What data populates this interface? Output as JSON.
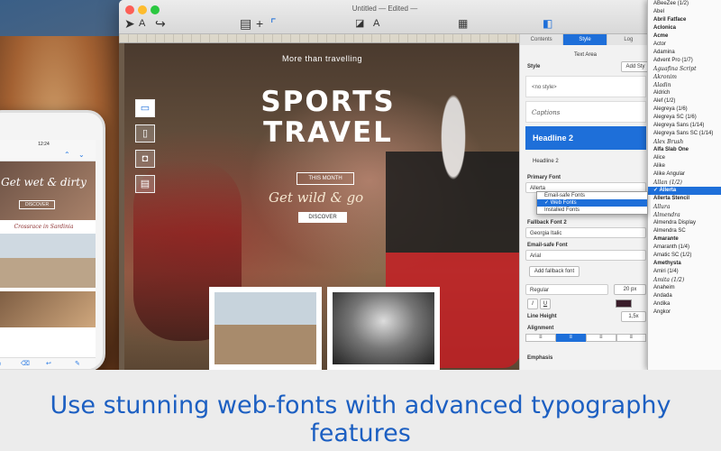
{
  "window": {
    "title": "Untitled — Edited —"
  },
  "toolbar": {
    "icons": [
      "pointer-icon",
      "text-tool-icon",
      "share-icon",
      "layout-icon",
      "plus-icon",
      "corner-icon",
      "image-icon",
      "text-icon",
      "grid-icon",
      "sidebar-icon"
    ]
  },
  "canvas": {
    "subtitle": "More than travelling",
    "title": "SPORTS TRAVEL",
    "this_month": "THIS MONTH",
    "tagline": "Get wild & go",
    "discover": "DISCOVER"
  },
  "panel": {
    "tabs": [
      "Contents",
      "Style",
      "Log"
    ],
    "text_area_label": "Text Area",
    "style_label": "Style",
    "add_style": "Add Sty",
    "no_style": "<no style>",
    "captions": "Captions",
    "headline_2_box": "Headline 2",
    "headline_2_label": "Headline 2",
    "primary_font_label": "Primary Font",
    "primary_font_value": "Allerta",
    "popup": [
      "Email-safe Fonts",
      "Web Fonts",
      "Installed Fonts"
    ],
    "fallback_font_label": "Fallback Font 2",
    "fallback_font_value": "Georgia Italic",
    "email_safe_label": "Email-safe Font",
    "email_safe_value": "Arial",
    "add_fallback": "Add fallback font",
    "weight": "Regular",
    "size": "20 px",
    "italic": "I",
    "underline": "U",
    "line_height_label": "Line Height",
    "line_height_value": "1,5x",
    "alignment_label": "Alignment",
    "emphasis_label": "Emphasis"
  },
  "fonts": [
    "ABeeZee (1/2)",
    "Abel",
    "Abril Fatface",
    "Aclonica",
    "Acme",
    "Actor",
    "Adamina",
    "Advent Pro (1/7)",
    "Aguafina Script",
    "Akronim",
    "Aladin",
    "Aldrich",
    "Alef (1/2)",
    "Alegreya (1/6)",
    "Alegreya SC (1/6)",
    "Alegreya Sans (1/14)",
    "Alegreya Sans SC (1/14)",
    "Alex Brush",
    "Alfa Slab One",
    "Alice",
    "Alike",
    "Alike Angular",
    "Allan (1/2)",
    "Allerta",
    "Allerta Stencil",
    "Allura",
    "Almendra",
    "Almendra Display",
    "Almendra SC",
    "Amarante",
    "Amaranth (1/4)",
    "Amatic SC (1/2)",
    "Amethysta",
    "Amiri (1/4)",
    "Amita (1/2)",
    "Anaheim",
    "Andada",
    "Andika",
    "Angkor"
  ],
  "selected_font": "Allerta",
  "phone": {
    "time": "12:24",
    "hero_title": "Get wet & dirty",
    "discover": "DISCOVER",
    "caption": "Crossrace in Sardinia"
  },
  "caption": "Use stunning web-fonts with advanced typography features"
}
